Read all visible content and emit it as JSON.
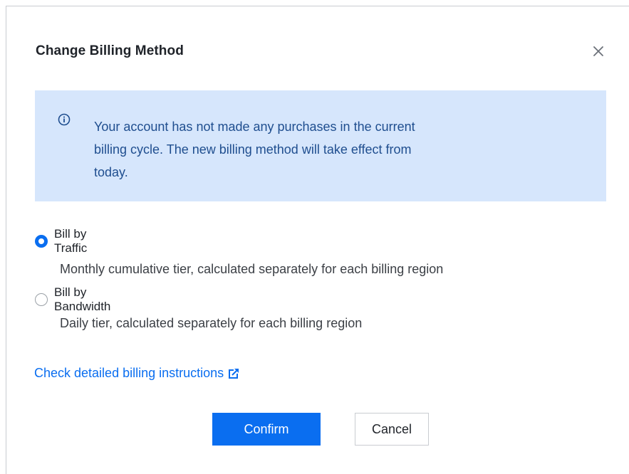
{
  "dialog": {
    "title": "Change Billing Method",
    "close_icon": "close-icon"
  },
  "notice": {
    "icon": "info-icon",
    "line1": "Your account has not made any purchases in the current",
    "line2": "billing cycle. The new billing method will take effect from",
    "line3": "today."
  },
  "options": [
    {
      "label": "Bill by Traffic",
      "description": "Monthly cumulative tier, calculated separately for each billing region",
      "checked": true
    },
    {
      "label": "Bill by Bandwidth",
      "description": "Daily tier, calculated separately for each billing region",
      "checked": false
    }
  ],
  "link": {
    "label": "Check detailed billing instructions",
    "icon": "external-link-icon"
  },
  "buttons": {
    "confirm": "Confirm",
    "cancel": "Cancel"
  },
  "colors": {
    "primary": "#0a6ef0",
    "notice_bg": "#d6e6fc",
    "notice_text": "#1f4e8f"
  }
}
